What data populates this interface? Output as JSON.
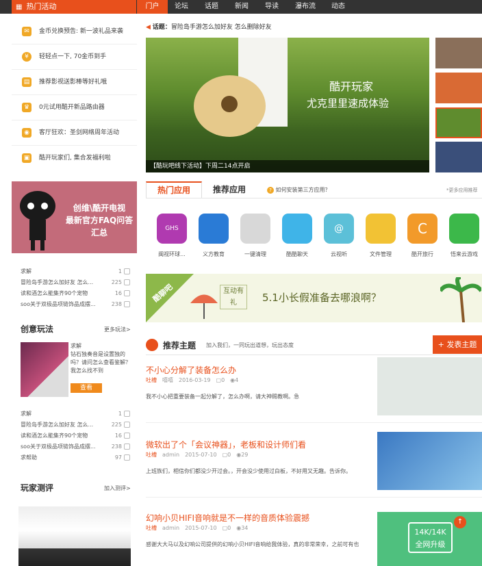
{
  "nav": {
    "hot_label": "热门活动",
    "items": [
      "门户",
      "论坛",
      "话题",
      "新闻",
      "导读",
      "瀑布流",
      "动态"
    ]
  },
  "activities": [
    {
      "icon": "ticket-icon",
      "label": "金币兑换预告: 新一波礼品来袭"
    },
    {
      "icon": "coin-icon",
      "label": "轻轻点一下, 70金币到手"
    },
    {
      "icon": "video-icon",
      "label": "推荐影视送影棒等好礼哦"
    },
    {
      "icon": "crown-icon",
      "label": "0元试用酷开新品路由器"
    },
    {
      "icon": "gamepad-icon",
      "label": "客厅狂欢：圣剑网络周年活动"
    },
    {
      "icon": "gift-icon",
      "label": "酷开玩家们, 集合发福利啦"
    }
  ],
  "faq_banner": {
    "line1": "创维\\酷开电视",
    "line2": "最新官方FAQ问答汇总"
  },
  "list1": [
    {
      "title": "求解",
      "count": "1"
    },
    {
      "title": "冒险岛手游怎么加好友 怎么...",
      "count": "225"
    },
    {
      "title": "读和酒怎么能集齐90个宠物",
      "count": "16"
    },
    {
      "title": "soo关于双极品项链饰品成摆...",
      "count": "238"
    }
  ],
  "creative": {
    "title": "创意玩法",
    "more": "更多玩法>",
    "text_head": "求解",
    "text_body": "钻石独奏音是设置独的吗？请问怎么查看鉴解？我怎么找不到",
    "button": "查看"
  },
  "list2": [
    {
      "title": "求解",
      "count": "1"
    },
    {
      "title": "冒险岛手游怎么加好友 怎么...",
      "count": "225"
    },
    {
      "title": "读和酒怎么能集齐90个宠物",
      "count": "16"
    },
    {
      "title": "soo关于双极品项链饰品成摆...",
      "count": "238"
    },
    {
      "title": "求帮助",
      "count": "97"
    }
  ],
  "review": {
    "title": "玩家测评",
    "more": "加入测评>"
  },
  "topic": {
    "label": "话题：",
    "text": "冒险岛手游怎么加好友 怎么删除好友"
  },
  "hero": {
    "line1": "酷开玩家",
    "line2": "尤克里里速成体验",
    "caption": "【酷玩吧线下活动】下周二14点开启"
  },
  "apps_tabs": {
    "hot": "热门应用",
    "rec": "推荐应用",
    "how": "如何安装第三方应用？",
    "more": "*更多应用推荐"
  },
  "apps": [
    {
      "name": "闽视环球...",
      "color": "#b03ab0",
      "label": "GHS"
    },
    {
      "name": "义方教育",
      "color": "#2a7bd6",
      "label": ""
    },
    {
      "name": "一键清理",
      "color": "#d8d8d8",
      "label": ""
    },
    {
      "name": "酷酷聊天",
      "color": "#3fb4e8",
      "label": ""
    },
    {
      "name": "云视听",
      "color": "#5cc0d8",
      "label": "@"
    },
    {
      "name": "文件管理",
      "color": "#f2c234",
      "label": ""
    },
    {
      "name": "酷开旅行",
      "color": "#f29a2a",
      "label": "C"
    },
    {
      "name": "悟来云游戏",
      "color": "#3cb84a",
      "label": ""
    }
  ],
  "banner": {
    "badge": "酷聊吧",
    "tag": "互动有礼",
    "text": "5.1小长假准备去哪浪啊？"
  },
  "recommend": {
    "title": "推荐主题",
    "sub": "加入我们，一同玩出道想，玩出态度",
    "post_button": "+ 发表主题"
  },
  "posts": [
    {
      "title": "不小心分解了装备怎么办",
      "cat": "吐槽",
      "user": "嘻嘻",
      "date": "2016-03-19",
      "comments": "0",
      "views": "4",
      "excerpt": "我不小心把重要装备一起分解了，怎么办啊，请大神赐教啊。急"
    },
    {
      "title": "微软出了个「会议神器」，老板和设计师们看",
      "cat": "吐槽",
      "user": "admin",
      "date": "2015-07-10",
      "comments": "0",
      "views": "29",
      "excerpt": "上班族们，相信你们都没少开过会。，开会没少使用过白板，不好用又无趣。告诉你。"
    },
    {
      "title": "幻响小贝HIFI音响就是不一样的音质体验震撼",
      "cat": "吐槽",
      "user": "admin",
      "date": "2015-07-10",
      "comments": "0",
      "views": "34",
      "excerpt": "感谢大大马以及幻响公司提供的幻响小贝HIFI音响给我体验，真的非常荣幸，之前可有也"
    }
  ],
  "upgrade": {
    "line1": "14K/14K",
    "line2": "全网升级"
  }
}
